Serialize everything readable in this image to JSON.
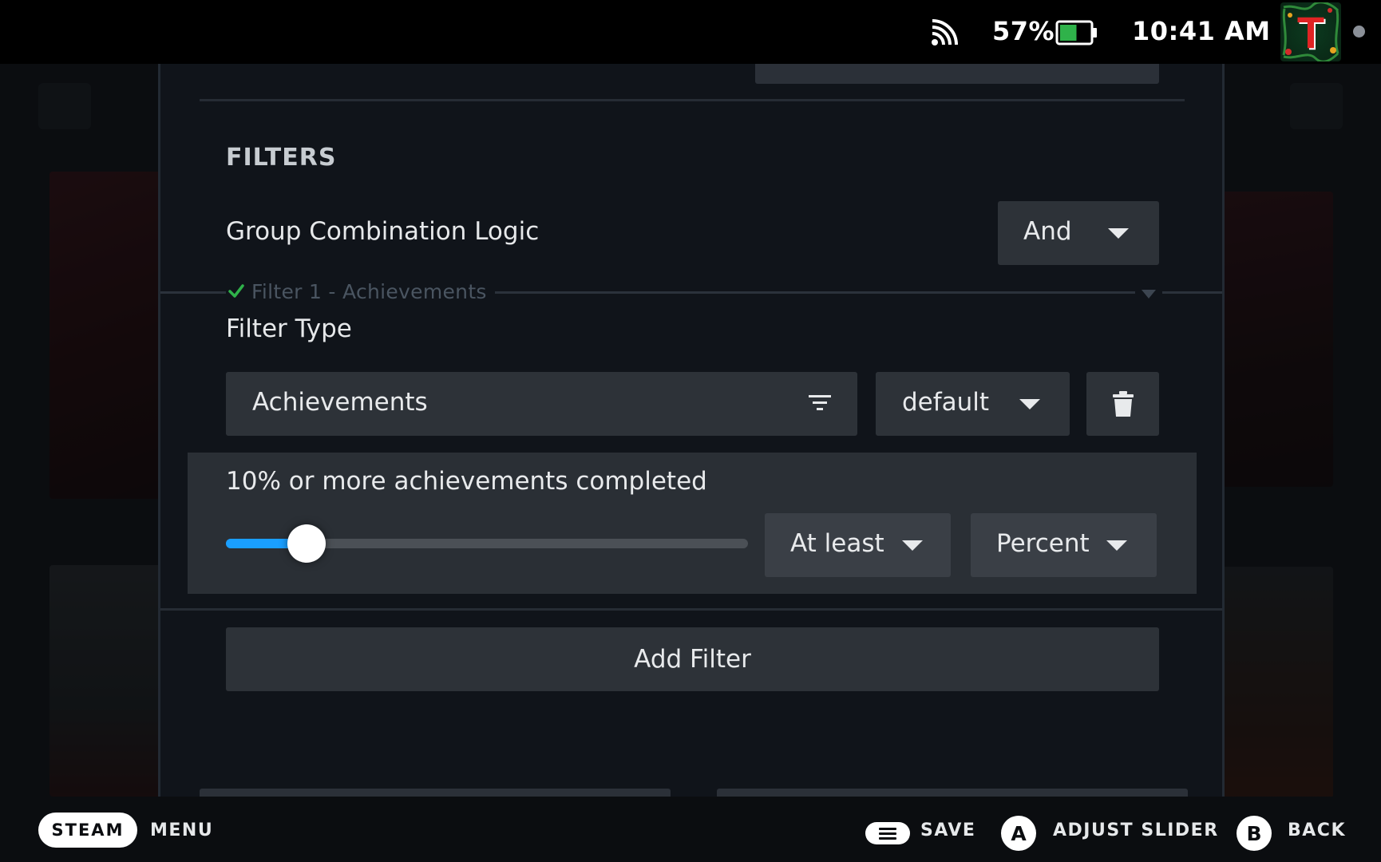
{
  "status_bar": {
    "battery_percent": "57%",
    "battery_level": 0.57,
    "time": "10:41 AM",
    "avatar_letter": "T",
    "icons": [
      "wifi-icon",
      "battery-icon",
      "avatar",
      "notification-dot"
    ]
  },
  "filters": {
    "section_title": "FILTERS",
    "group_logic_label": "Group Combination Logic",
    "group_logic_value": "And",
    "group": {
      "title": "Filter 1 - Achievements",
      "valid": true,
      "filter_type_label": "Filter Type",
      "filter_type_value": "Achievements",
      "mode_value": "default",
      "slider_caption": "10% or more achievements completed",
      "slider_value": 0.1,
      "comparison_value": "At least",
      "unit_value": "Percent"
    },
    "add_filter_label": "Add Filter"
  },
  "footer": {
    "steam_label": "STEAM",
    "menu_label": "MENU",
    "save_label": "SAVE",
    "a_button": "A",
    "adjust_label": "ADJUST SLIDER",
    "b_button": "B",
    "back_label": "BACK"
  },
  "colors": {
    "accent": "#1a9fff",
    "success": "#2fb24a",
    "panel_bg": "#10141a",
    "control_bg": "#2d3238"
  }
}
